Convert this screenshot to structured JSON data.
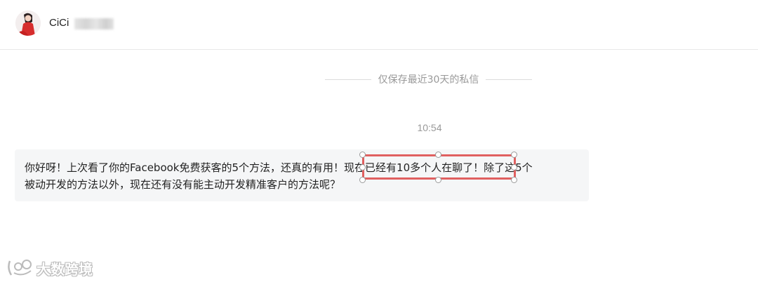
{
  "header": {
    "avatar_icon": "user-avatar-icon",
    "contact_name": "CiCi"
  },
  "notice": {
    "text": "仅保存最近30天的私信"
  },
  "conversation": {
    "timestamp": "10:54",
    "message": {
      "line1_before": "你好呀！上次看了你的Facebook免费获客的5个方法，还真的有用！",
      "line1_highlight": "现在已经有10多个人在聊了！",
      "line1_after": "除了这5个",
      "line2": "被动开发的方法以外，现在还有没有能主动开发精准客户的方法呢？"
    },
    "highlight_color": "#e06060",
    "bubble_color": "#f5f6f7"
  },
  "watermark": {
    "text": "大数跨境",
    "logo_icon": "watermark-logo-icon"
  }
}
